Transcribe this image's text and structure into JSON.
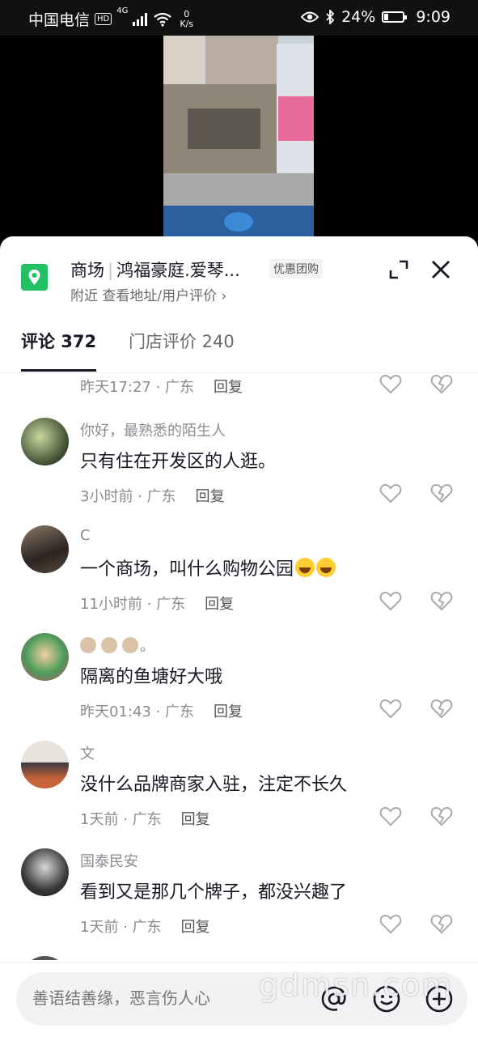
{
  "status_bar": {
    "carrier": "中国电信",
    "hd": "HD",
    "network": "4G",
    "net_speed_value": "0",
    "net_speed_unit": "K/s",
    "battery_percent": "24%",
    "battery_level": 0.24,
    "time": "9:09"
  },
  "poi": {
    "category": "商场",
    "name": "鸿福豪庭.爱琴...",
    "tag": "优惠团购",
    "subtitle": "附近  查看地址/用户评价 ›",
    "icon": "location-pin-icon",
    "accent": "#21c063"
  },
  "tabs": [
    {
      "label": "评论 372",
      "active": true
    },
    {
      "label": "门店评价 240",
      "active": false
    }
  ],
  "comments": [
    {
      "user": "",
      "text": "",
      "time": "昨天17:27 · 广东",
      "reply": "回复"
    },
    {
      "user": "你好，最熟悉的陌生人",
      "text": "只有住在开发区的人逛。",
      "time": "3小时前 · 广东",
      "reply": "回复"
    },
    {
      "user": "C",
      "text": "一个商场，叫什么购物公园",
      "time": "11小时前 · 广东",
      "reply": "回复",
      "emojis": [
        "rofl-emoji",
        "rofl-emoji"
      ]
    },
    {
      "user": "。",
      "text": "隔离的鱼塘好大哦",
      "time": "昨天01:43 · 广东",
      "reply": "回复",
      "name_icons": [
        "monkey-emoji",
        "monkey-emoji",
        "monkey-emoji"
      ]
    },
    {
      "user": "文",
      "text": "没什么品牌商家入驻，注定不长久",
      "time": "1天前 · 广东",
      "reply": "回复"
    },
    {
      "user": "国泰民安",
      "text": "看到又是那几个牌子，都没兴趣了",
      "time": "1天前 · 广东",
      "reply": "回复"
    }
  ],
  "input": {
    "placeholder": "善语结善缘，恶言伤人心",
    "icons": [
      "at-icon",
      "emoji-icon",
      "plus-icon"
    ]
  },
  "watermark": "gdmsn.com"
}
